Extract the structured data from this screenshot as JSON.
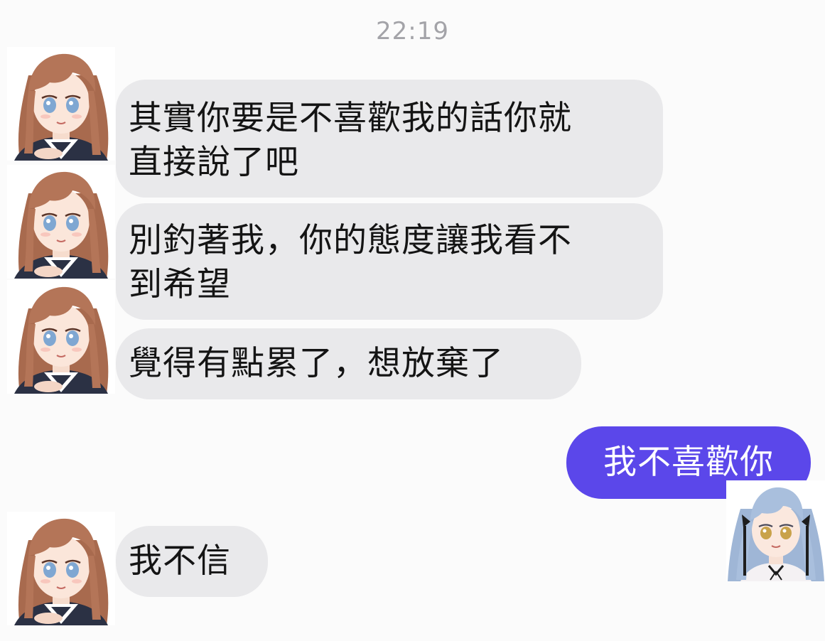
{
  "chat": {
    "timestamp": "22:19",
    "messages": [
      {
        "sender": "other",
        "text": "其實你要是不喜歡我的話你就\n直接說了吧",
        "avatar": "brown-hair-girl-avatar"
      },
      {
        "sender": "other",
        "text": "別釣著我，你的態度讓我看不\n到希望",
        "avatar": "brown-hair-girl-avatar"
      },
      {
        "sender": "other",
        "text": "覺得有點累了，想放棄了",
        "avatar": "brown-hair-girl-avatar"
      },
      {
        "sender": "me",
        "text": "我不喜歡你",
        "avatar": "blue-hair-girl-avatar"
      },
      {
        "sender": "other",
        "text": "我不信",
        "avatar": "brown-hair-girl-avatar"
      }
    ]
  },
  "colors": {
    "incoming_bubble": "#e9e9eb",
    "outgoing_bubble": "#5b47ea",
    "timestamp": "#a3a3a8",
    "background": "#fbfbfb"
  }
}
